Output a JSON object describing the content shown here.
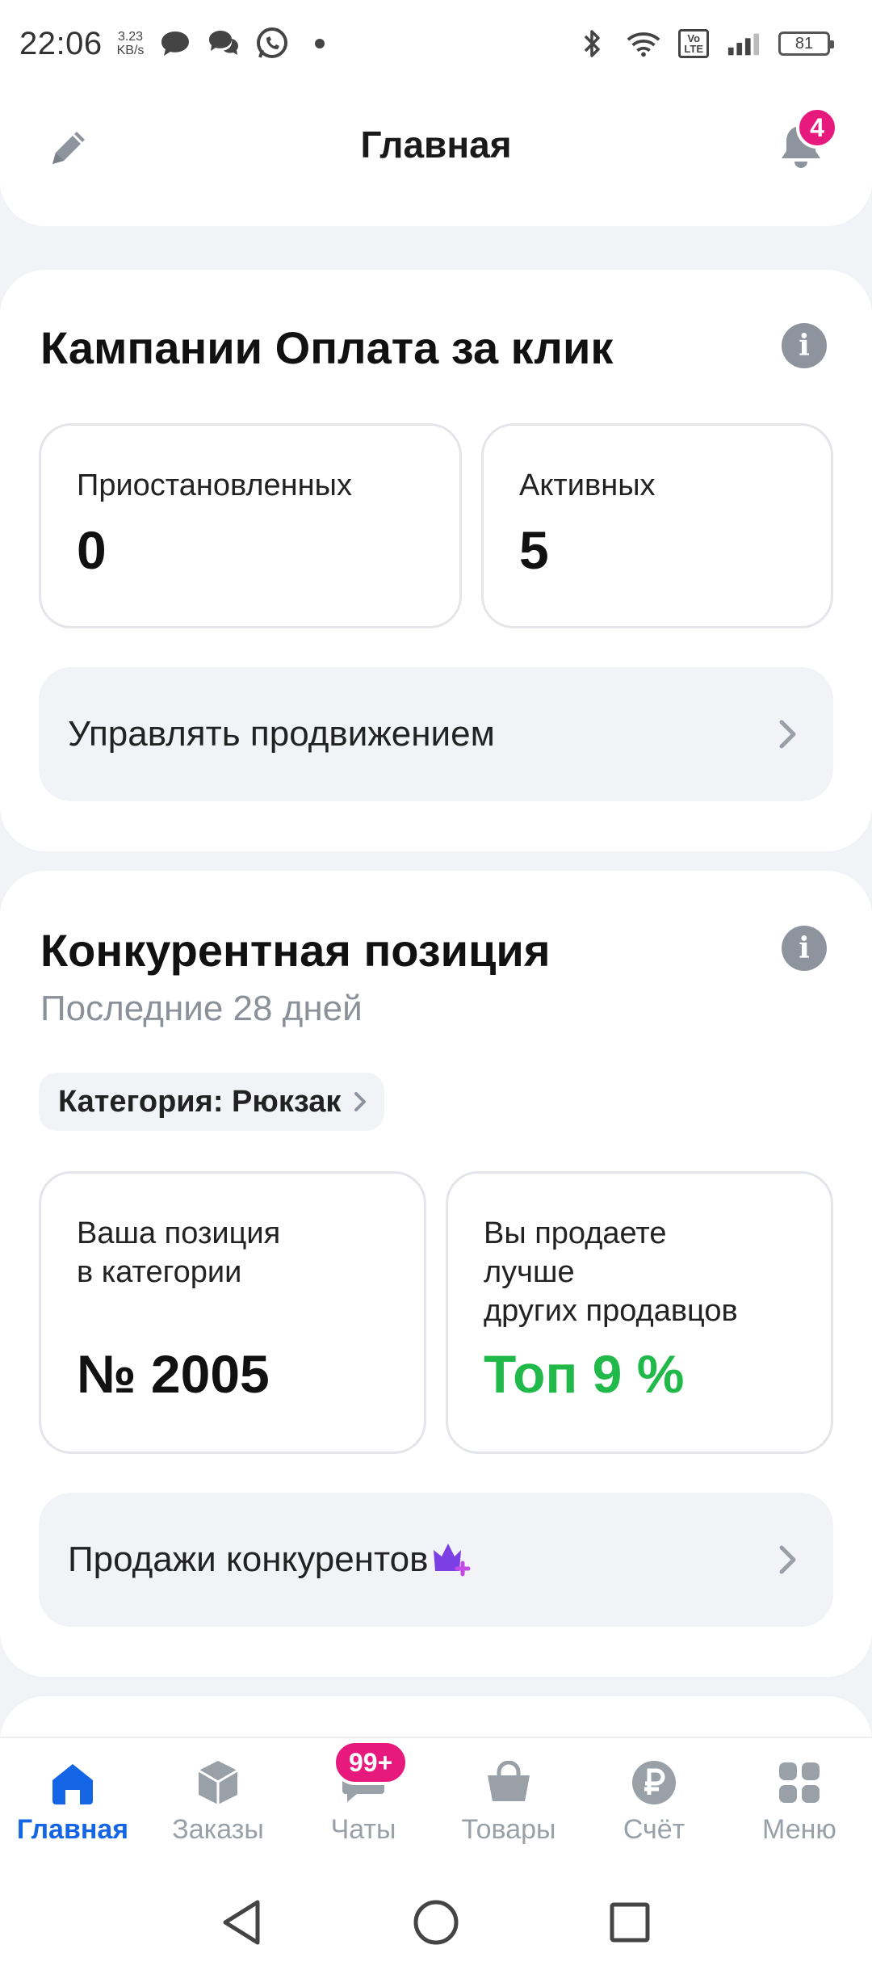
{
  "status_bar": {
    "time": "22:06",
    "net_speed_value": "3.23",
    "net_speed_unit": "KB/s",
    "volte_top": "Vo",
    "volte_bottom": "LTE",
    "battery": "81"
  },
  "header": {
    "title": "Главная",
    "notifications_count": "4"
  },
  "ppc_campaigns": {
    "title": "Кампании Оплата за клик",
    "paused_label": "Приостановленных",
    "paused_value": "0",
    "active_label": "Активных",
    "active_value": "5",
    "manage_label": "Управлять продвижением"
  },
  "competitive_position": {
    "title": "Конкурентная позиция",
    "period": "Последние 28 дней",
    "category_chip": "Категория: Рюкзак",
    "position_label_line1": "Ваша позиция",
    "position_label_line2": "в категории",
    "position_value": "№ 2005",
    "sell_better_line1": "Вы продаете",
    "sell_better_line2": "лучше",
    "sell_better_line3": "других продавцов",
    "top_value": "Топ 9 %",
    "competitor_sales_label": "Продажи конкурентов"
  },
  "bottom_nav": {
    "items": [
      {
        "label": "Главная",
        "icon": "home-icon",
        "active": true
      },
      {
        "label": "Заказы",
        "icon": "box-icon"
      },
      {
        "label": "Чаты",
        "icon": "chat-icon",
        "badge": "99+"
      },
      {
        "label": "Товары",
        "icon": "basket-icon"
      },
      {
        "label": "Счёт",
        "icon": "ruble-icon"
      },
      {
        "label": "Меню",
        "icon": "grid-icon"
      }
    ]
  },
  "colors": {
    "accent_blue": "#1466e6",
    "badge_pink": "#e8197c",
    "top_green": "#21b94a",
    "premium_purple": "#7b3fe4"
  }
}
